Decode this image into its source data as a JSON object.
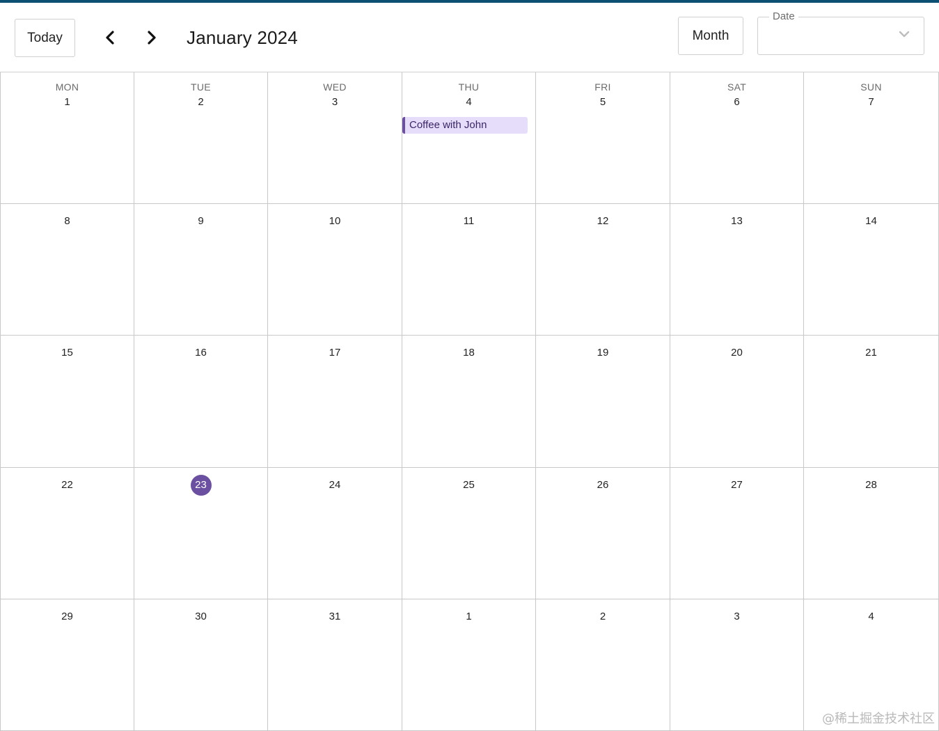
{
  "toolbar": {
    "today_label": "Today",
    "title": "January 2024",
    "view_label": "Month",
    "date_field_label": "Date",
    "date_field_value": ""
  },
  "weekday_headers": [
    "MON",
    "TUE",
    "WED",
    "THU",
    "FRI",
    "SAT",
    "SUN"
  ],
  "weeks": [
    [
      "1",
      "2",
      "3",
      "4",
      "5",
      "6",
      "7"
    ],
    [
      "8",
      "9",
      "10",
      "11",
      "12",
      "13",
      "14"
    ],
    [
      "15",
      "16",
      "17",
      "18",
      "19",
      "20",
      "21"
    ],
    [
      "22",
      "23",
      "24",
      "25",
      "26",
      "27",
      "28"
    ],
    [
      "29",
      "30",
      "31",
      "1",
      "2",
      "3",
      "4"
    ]
  ],
  "today": {
    "week": 3,
    "day": 1
  },
  "events": [
    {
      "title": "Coffee with John",
      "week": 0,
      "day": 3
    }
  ],
  "colors": {
    "accent": "#6b4fa0",
    "event_bg": "#e6ddfb",
    "top_bar": "#0d4f73"
  },
  "icons": {
    "prev": "chevron-left-icon",
    "next": "chevron-right-icon",
    "dropdown": "chevron-down-icon"
  },
  "watermark": "@稀土掘金技术社区"
}
